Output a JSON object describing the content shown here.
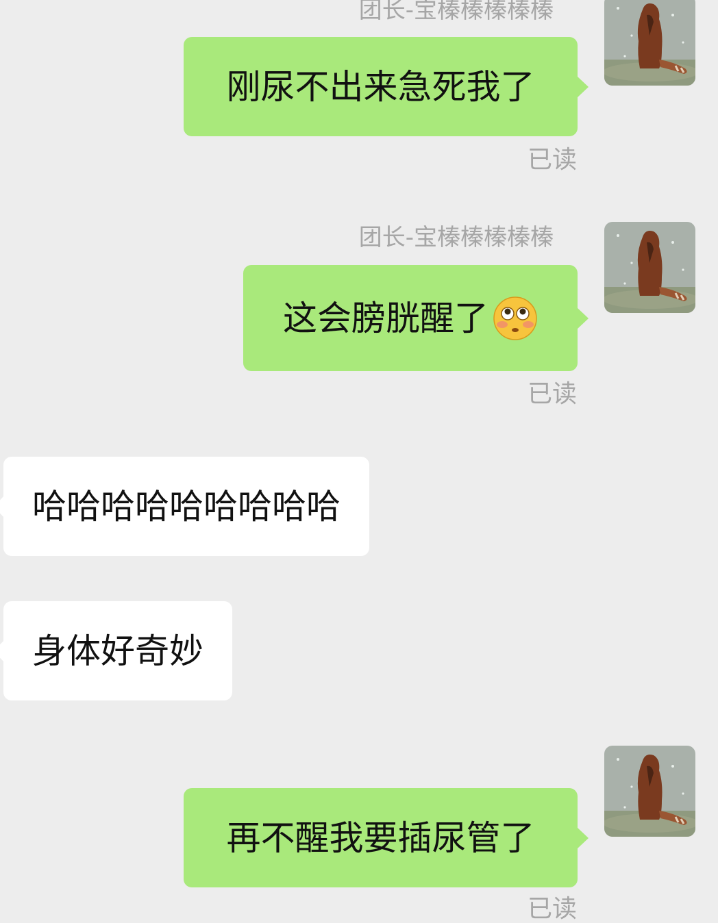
{
  "messages": [
    {
      "direction": "outgoing",
      "sender": "团长-宝榛榛榛榛榛",
      "text": "刚尿不出来急死我了",
      "status": "已读"
    },
    {
      "direction": "outgoing",
      "sender": "团长-宝榛榛榛榛榛",
      "text": "这会膀胱醒了",
      "emoji": "flushed-face",
      "status": "已读"
    },
    {
      "direction": "incoming",
      "text": "哈哈哈哈哈哈哈哈哈"
    },
    {
      "direction": "incoming",
      "text": "身体好奇妙"
    },
    {
      "direction": "outgoing",
      "text": "再不醒我要插尿管了",
      "status": "已读"
    }
  ],
  "avatar": {
    "icon": "red-panda-avatar"
  },
  "colors": {
    "background": "#ededed",
    "outgoing_bubble": "#a9e97b",
    "incoming_bubble": "#ffffff",
    "meta_text": "#a6a6a6"
  }
}
